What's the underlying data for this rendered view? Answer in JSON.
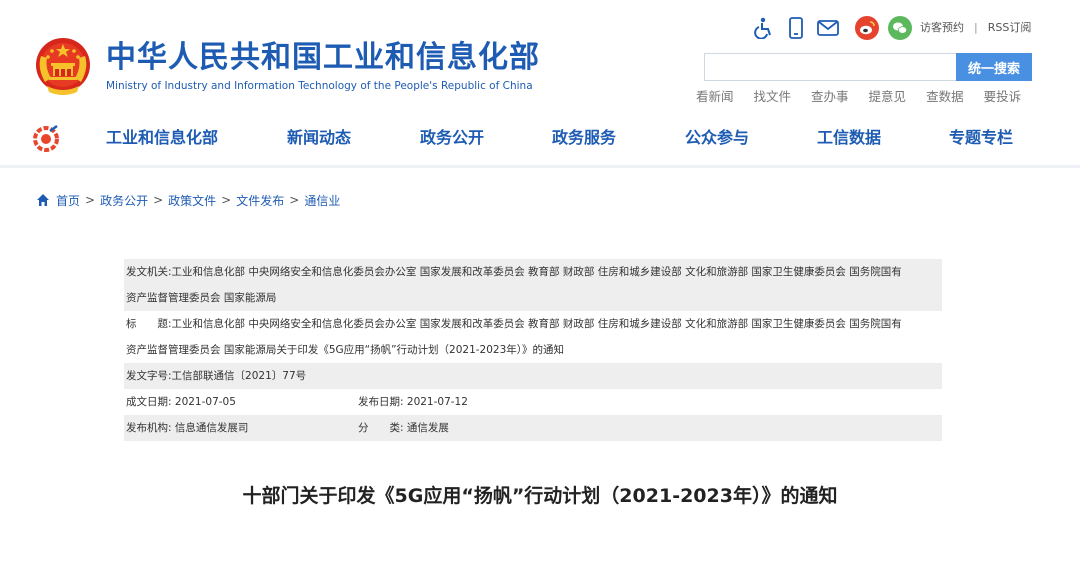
{
  "header": {
    "site_title": "中华人民共和国工业和信息化部",
    "site_subtitle": "Ministry of Industry and Information Technology of the People's Republic of China",
    "utility": {
      "icons": [
        "accessibility-icon",
        "mobile-icon",
        "mail-icon",
        "weibo-icon",
        "wechat-icon"
      ],
      "visitor_label": "访客预约",
      "separator": "|",
      "rss_label": "RSS订阅"
    },
    "search": {
      "placeholder": "",
      "button_label": "统一搜索"
    },
    "quick_links": [
      "看新闻",
      "找文件",
      "查办事",
      "提意见",
      "查数据",
      "要投诉"
    ]
  },
  "nav": {
    "items": [
      "工业和信息化部",
      "新闻动态",
      "政务公开",
      "政务服务",
      "公众参与",
      "工信数据",
      "专题专栏"
    ]
  },
  "breadcrumb": [
    "首页",
    "政务公开",
    "政策文件",
    "文件发布",
    "通信业"
  ],
  "breadcrumb_sep": ">",
  "meta": {
    "issuer_label": "发文机关:",
    "issuer_line1": "工业和信息化部 中央网络安全和信息化委员会办公室 国家发展和改革委员会 教育部 财政部 住房和城乡建设部 文化和旅游部 国家卫生健康委员会 国务院国有",
    "issuer_line2": "资产监督管理委员会 国家能源局",
    "title_label": "标　　题:",
    "title_line1": "工业和信息化部 中央网络安全和信息化委员会办公室 国家发展和改革委员会 教育部 财政部 住房和城乡建设部 文化和旅游部 国家卫生健康委员会 国务院国有",
    "title_line2": "资产监督管理委员会 国家能源局关于印发《5G应用“扬帆”行动计划（2021-2023年）》的通知",
    "doc_no_label": "发文字号:",
    "doc_no": "工信部联通信〔2021〕77号",
    "created_label": "成文日期:",
    "created": "2021-07-05",
    "published_label": "发布日期:",
    "published": "2021-07-12",
    "org_label": "发布机构:",
    "org": "信息通信发展司",
    "category_label": "分　　类:",
    "category": "通信发展"
  },
  "document": {
    "title": "十部门关于印发《5G应用“扬帆”行动计划（2021-2023年）》的通知"
  },
  "colors": {
    "brand_blue": "#1e5cb3",
    "search_button": "#4a90e2",
    "weibo": "#e6432e",
    "wechat": "#5cb85c",
    "row_shade": "#eeeeee"
  }
}
